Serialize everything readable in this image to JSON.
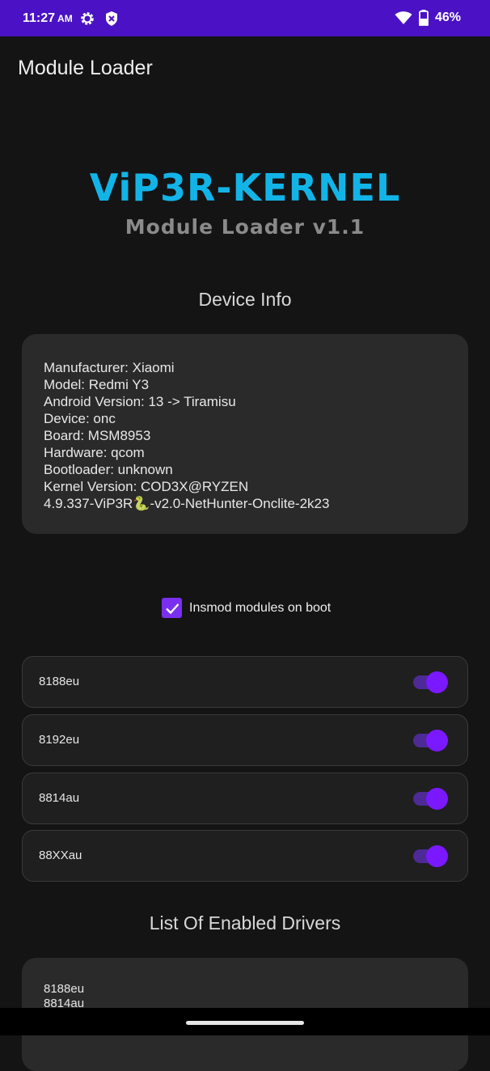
{
  "status_bar": {
    "time": "11:27",
    "ampm": "AM",
    "battery": "46%",
    "icons": [
      "settings-gear-icon",
      "shield-icon",
      "wifi-icon",
      "battery-icon"
    ]
  },
  "app_bar": {
    "title": "Module Loader"
  },
  "brand": {
    "title": "ViP3R-KERNEL",
    "subtitle": "Module Loader v1.1"
  },
  "device_info": {
    "heading": "Device Info",
    "lines": [
      "Manufacturer: Xiaomi",
      "Model: Redmi Y3",
      "Android Version: 13 -> Tiramisu",
      "Device: onc",
      "Board: MSM8953",
      "Hardware: qcom",
      "Bootloader: unknown",
      "Kernel Version: COD3X@RYZEN",
      "4.9.337-ViP3R🐍-v2.0-NetHunter-Onclite-2k23"
    ]
  },
  "boot_option": {
    "label": "Insmod modules on boot",
    "checked": true
  },
  "modules": [
    {
      "name": "8188eu",
      "enabled": true
    },
    {
      "name": "8192eu",
      "enabled": true
    },
    {
      "name": "8814au",
      "enabled": true
    },
    {
      "name": "88XXau",
      "enabled": true
    }
  ],
  "enabled_drivers": {
    "heading": "List Of Enabled Drivers",
    "items": [
      "8188eu",
      "8814au"
    ]
  },
  "colors": {
    "status_bar": "#4a12c4",
    "accent": "#7a18ff",
    "brand": "#12b4e8",
    "background": "#141414"
  }
}
